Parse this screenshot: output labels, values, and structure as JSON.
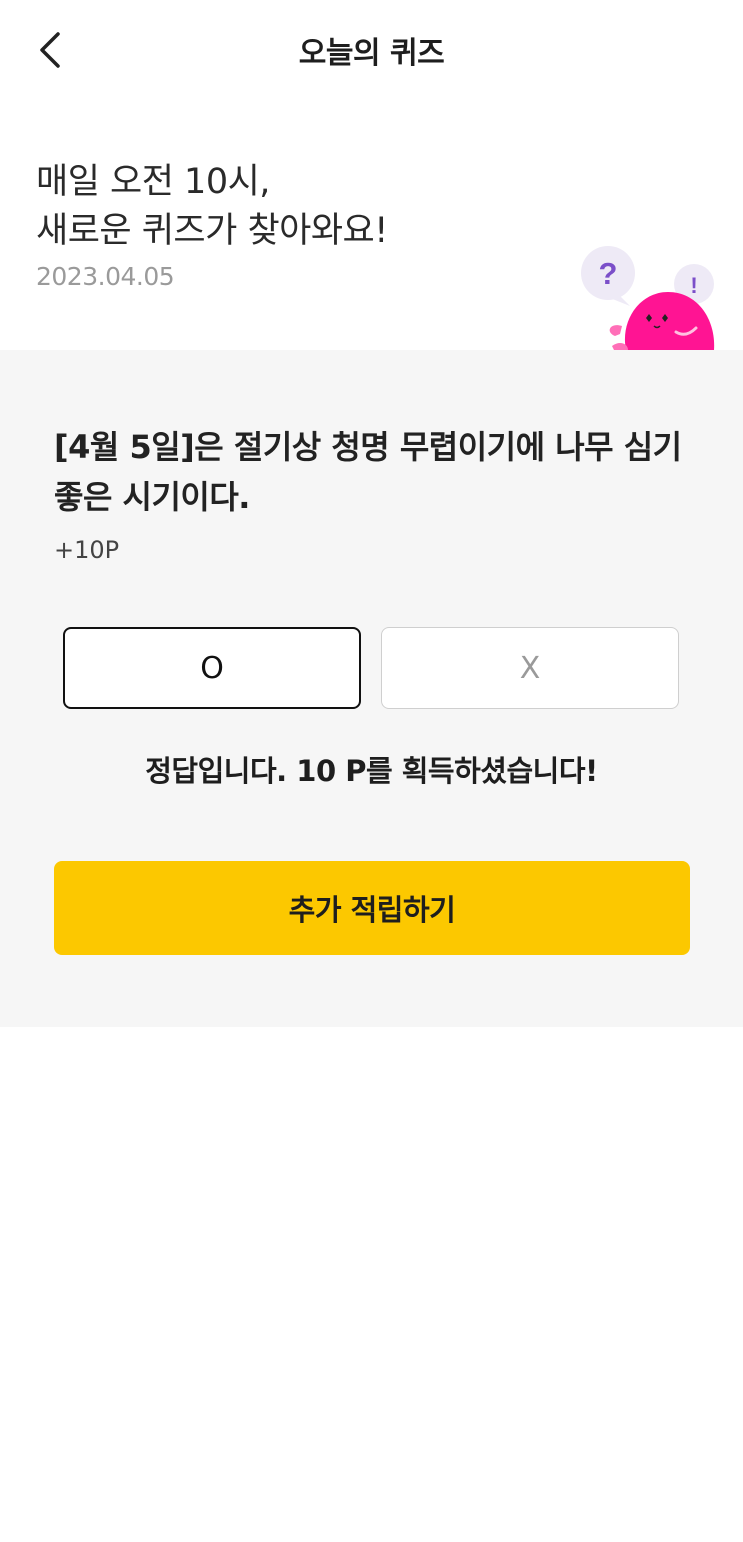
{
  "header": {
    "title": "오늘의 퀴즈",
    "back_icon": "chevron-left-icon"
  },
  "intro": {
    "line1": "매일 오전 10시,",
    "line2": "새로운 퀴즈가 찾아와요!",
    "date": "2023.04.05"
  },
  "mascot": {
    "question_mark": "?",
    "exclamation_mark": "!",
    "icon": "mascot-illustration",
    "colors": {
      "body": "#ff1493",
      "bubble": "#eeeaf6",
      "mark": "#7b4fc9"
    }
  },
  "quiz": {
    "question": "[4월 5일]은 절기상 청명 무렵이기에 나무 심기 좋은 시기이다.",
    "points": "+10P",
    "options": [
      {
        "label": "O",
        "selected": true
      },
      {
        "label": "X",
        "selected": false
      }
    ],
    "result": "정답입니다. 10 P를 획득하셨습니다!",
    "cta_label": "추가 적립하기"
  },
  "colors": {
    "accent": "#fcc800",
    "panel_bg": "#f6f6f6",
    "text": "#222222",
    "muted": "#9a9a9a"
  }
}
